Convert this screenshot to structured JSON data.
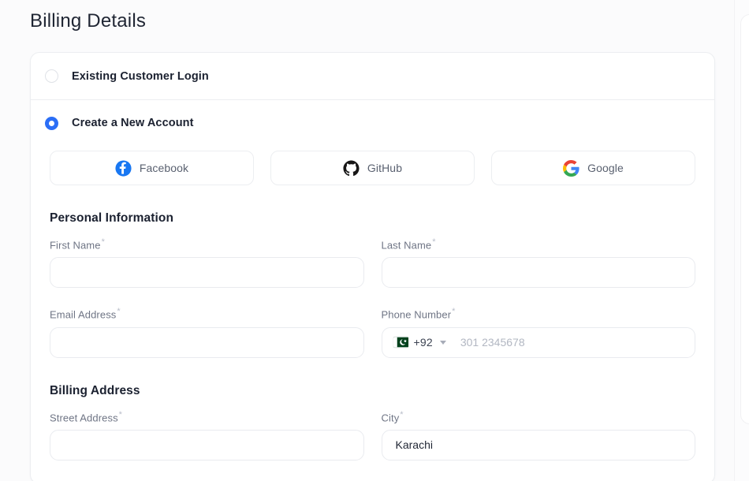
{
  "page": {
    "title": "Billing Details",
    "accent_color": "#2b6ef6",
    "background_color": "#fbfbfc",
    "card_background": "#ffffff"
  },
  "account_options": [
    {
      "label": "Existing Customer Login",
      "selected": false,
      "name": "existing-customer-login"
    },
    {
      "label": "Create a New Account",
      "selected": true,
      "name": "create-new-account"
    }
  ],
  "social_logins": [
    {
      "label": "Facebook",
      "icon": "facebook-icon",
      "color": "#1877F2"
    },
    {
      "label": "GitHub",
      "icon": "github-icon",
      "color": "#181717"
    },
    {
      "label": "Google",
      "icon": "google-icon",
      "color": "#4285F4"
    }
  ],
  "personal_information": {
    "heading": "Personal Information",
    "fields": {
      "first_name": {
        "label": "First Name",
        "required_marker": "*",
        "value": "",
        "placeholder": ""
      },
      "last_name": {
        "label": "Last Name",
        "required_marker": "*",
        "value": "",
        "placeholder": ""
      },
      "email": {
        "label": "Email Address",
        "required_marker": "*",
        "value": "",
        "placeholder": ""
      },
      "phone": {
        "label": "Phone Number",
        "required_marker": "*",
        "dial_code": "+92",
        "country_flag": "pakistan-flag",
        "value": "",
        "placeholder": "301 2345678"
      }
    }
  },
  "billing_address": {
    "heading": "Billing Address",
    "fields": {
      "street": {
        "label": "Street Address",
        "required_marker": "*",
        "value": "",
        "placeholder": ""
      },
      "city": {
        "label": "City",
        "required_marker": "*",
        "value": "Karachi",
        "placeholder": ""
      }
    }
  }
}
